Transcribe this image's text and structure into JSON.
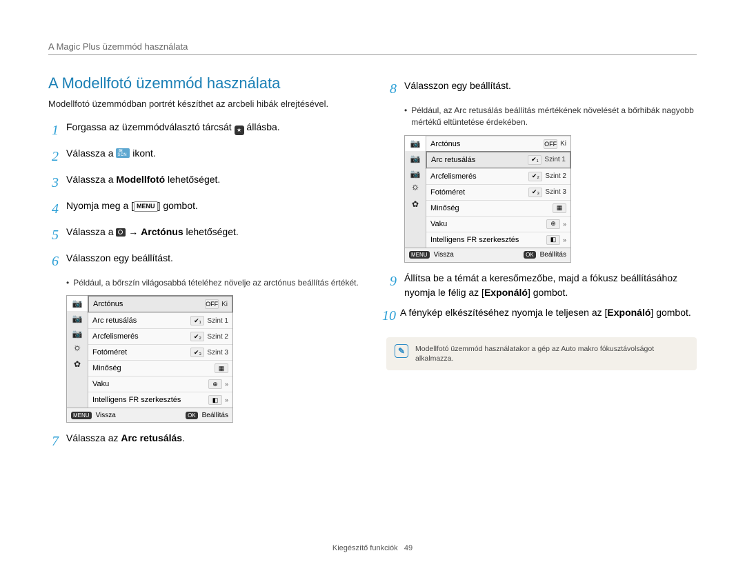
{
  "breadcrumb": "A Magic Plus üzemmód használata",
  "section_title": "A Modellfotó üzemmód használata",
  "intro": "Modellfotó üzemmódban portrét készíthet az arcbeli hibák elrejtésével.",
  "steps": [
    {
      "num": "1",
      "parts": [
        "Forgassa az üzemmódválasztó tárcsát ",
        {
          "icon": "star"
        },
        " állásba."
      ]
    },
    {
      "num": "2",
      "parts": [
        "Válassza a ",
        {
          "icon": "scn"
        },
        " ikont."
      ]
    },
    {
      "num": "3",
      "parts": [
        "Válassza a ",
        {
          "b": "Modellfotó"
        },
        " lehetőséget."
      ]
    },
    {
      "num": "4",
      "parts": [
        "Nyomja meg a [",
        {
          "menu": "MENU"
        },
        "] gombot."
      ]
    },
    {
      "num": "5",
      "parts": [
        "Válassza a ",
        {
          "icon": "cam"
        },
        " → ",
        {
          "b": "Arctónus"
        },
        " lehetőséget."
      ]
    },
    {
      "num": "6",
      "parts": [
        "Válasszon egy beállítást."
      ],
      "sub": "Például, a bőrszín világosabbá tételéhez növelje az arctónus beállítás értékét.",
      "menu_highlight": 0
    },
    {
      "num": "7",
      "parts": [
        "Válassza az ",
        {
          "b": "Arc retusálás"
        },
        "."
      ]
    },
    {
      "num": "8",
      "parts": [
        "Válasszon egy beállítást."
      ],
      "sub": "Például, az Arc retusálás beállítás mértékének növelését a bőrhibák nagyobb mértékű eltüntetése érdekében.",
      "menu_highlight": 1
    },
    {
      "num": "9",
      "parts": [
        "Állítsa be a témát a keresőmezőbe, majd a fókusz beállításához nyomja le félig az [",
        {
          "b": "Exponáló"
        },
        "] gombot."
      ]
    },
    {
      "num": "10",
      "parts": [
        "A fénykép elkészítéséhez nyomja le teljesen az [",
        {
          "b": "Exponáló"
        },
        "] gombot."
      ]
    }
  ],
  "menu_mock": {
    "rows": [
      {
        "label": "Arctónus",
        "icon": "OFF",
        "val": "Ki"
      },
      {
        "label": "Arc retusálás",
        "icon": "✔₁",
        "val": "Szint 1"
      },
      {
        "label": "Arcfelismerés",
        "icon": "✔₂",
        "val": "Szint 2"
      },
      {
        "label": "Fotóméret",
        "icon": "✔₃",
        "val": "Szint 3"
      },
      {
        "label": "Minőség",
        "icon": "▦",
        "val": ""
      },
      {
        "label": "Vaku",
        "icon": "⊕",
        "val": "",
        "chev": "»"
      },
      {
        "label": "Intelligens FR szerkesztés",
        "icon": "◧",
        "val": "",
        "chev": "»"
      }
    ],
    "footer": {
      "back_btn": "MENU",
      "back": "Vissza",
      "ok_btn": "OK",
      "ok": "Beállítás"
    }
  },
  "note": "Modellfotó üzemmód használatakor a gép az Auto makro fókusztávolságot alkalmazza.",
  "footer": {
    "label": "Kiegészítő funkciók",
    "page": "49"
  }
}
